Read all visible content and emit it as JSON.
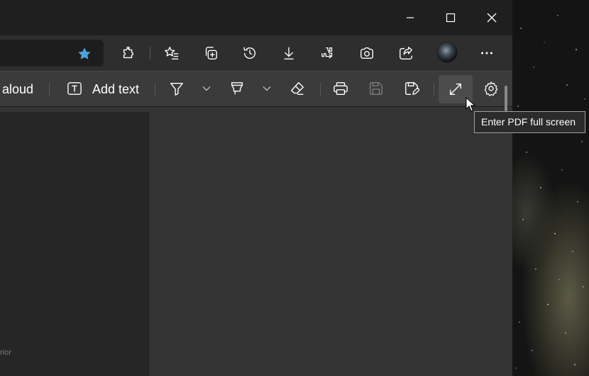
{
  "window": {
    "caption": {
      "minimize_icon": "minimize-icon",
      "maximize_icon": "maximize-icon",
      "close_icon": "close-icon"
    }
  },
  "toolbar": {
    "favorite_star_color": "#4aa3df",
    "icons": [
      "extensions-icon",
      "favorites-icon",
      "collections-icon",
      "history-icon",
      "downloads-icon",
      "performance-icon",
      "screenshot-icon",
      "share-icon",
      "profile-avatar",
      "more-icon"
    ]
  },
  "pdf_toolbar": {
    "read_aloud_label": "aloud",
    "add_text_label": "Add text",
    "icons": [
      "draw-icon",
      "highlight-icon",
      "erase-icon",
      "print-icon",
      "save-icon",
      "save-as-icon",
      "fullscreen-icon",
      "settings-icon"
    ]
  },
  "content": {
    "left_pane_text": "rior"
  },
  "tooltip": {
    "text": "Enter PDF full screen"
  },
  "colors": {
    "titlebar": "#1f1f1f",
    "toolbar": "#2e2e2e",
    "pdfbar": "#3b3b3b",
    "content": "#333333",
    "accent_star": "#4aa3df"
  }
}
